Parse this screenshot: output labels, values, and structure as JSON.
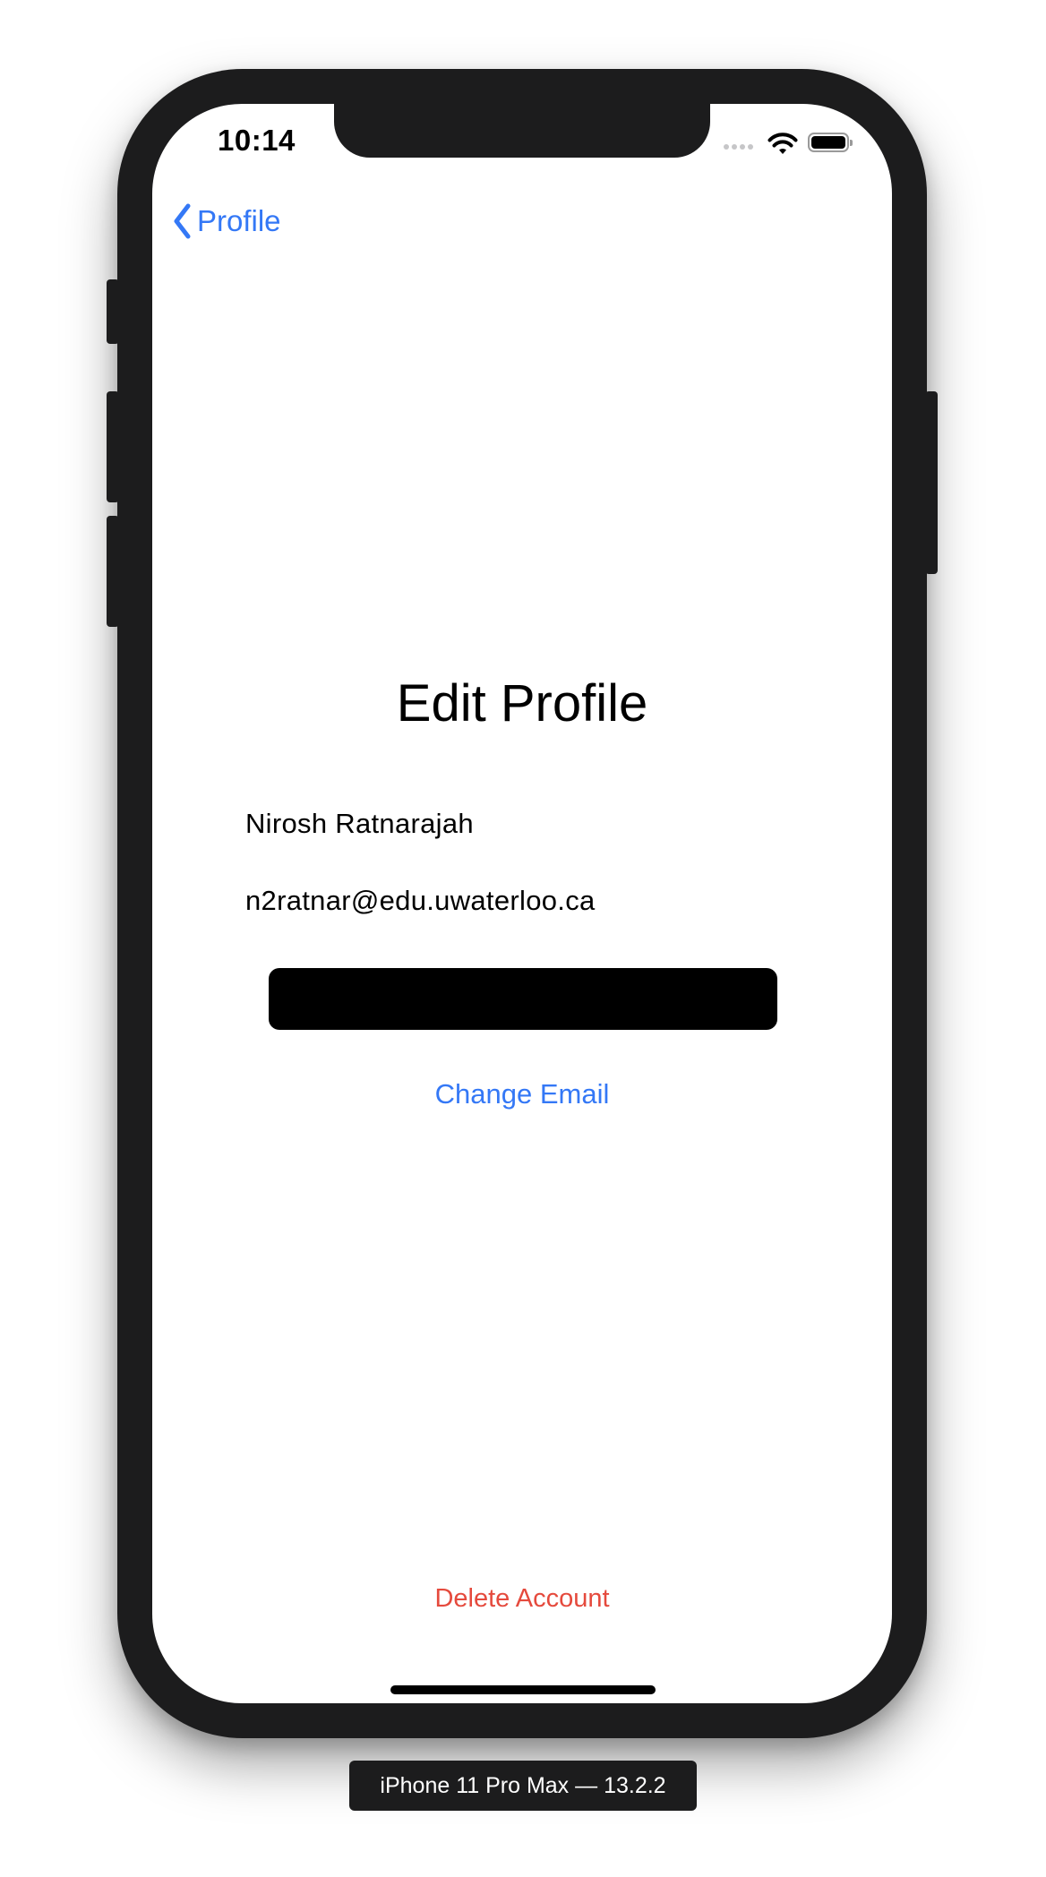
{
  "status_bar": {
    "time": "10:14"
  },
  "nav": {
    "back_label": "Profile"
  },
  "page": {
    "title": "Edit Profile",
    "name": "Nirosh Ratnarajah",
    "email": "n2ratnar@edu.uwaterloo.ca",
    "change_email_label": "Change Email",
    "delete_account_label": "Delete Account"
  },
  "device_label": "iPhone 11 Pro Max — 13.2.2",
  "colors": {
    "accent_blue": "#3478f6",
    "destructive_red": "#e54a3d",
    "frame": "#1c1c1d"
  },
  "icons": {
    "back": "chevron-left-icon",
    "wifi": "wifi-icon",
    "battery": "battery-icon",
    "signal": "cellular-signal-icon"
  }
}
